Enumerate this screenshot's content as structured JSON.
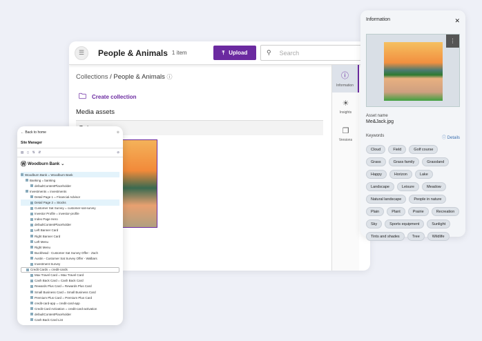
{
  "main": {
    "title": "People & Animals",
    "count": "1 item",
    "upload": "Upload",
    "search_placeholder": "Search",
    "breadcrumb": {
      "root": "Collections",
      "sep": "/",
      "current": "People & Animals"
    },
    "create_collection": "Create collection",
    "section": "Media assets",
    "group": "Today",
    "rail": [
      {
        "label": "Information",
        "icon": "info-icon"
      },
      {
        "label": "Insights",
        "icon": "sun-icon"
      },
      {
        "label": "Versions",
        "icon": "copy-icon"
      }
    ]
  },
  "info": {
    "title": "Information",
    "asset_name_label": "Asset name",
    "asset_name": "Me&Jack.jpg",
    "keywords_label": "Keywords",
    "details": "Details",
    "keywords": [
      "Cloud",
      "Field",
      "Golf course",
      "Grass",
      "Grass family",
      "Grassland",
      "Happy",
      "Horizon",
      "Lake",
      "Landscape",
      "Leisure",
      "Meadow",
      "Natural landscape",
      "People in nature",
      "Plain",
      "Plant",
      "Prairie",
      "Recreation",
      "Sky",
      "Sports equipment",
      "Sunlight",
      "Tints and shades",
      "Tree",
      "Wildlife"
    ]
  },
  "site_manager": {
    "back": "Back to home",
    "title": "Site Manager",
    "site": "Woodburn Bank",
    "tree": [
      {
        "t": "Woodburn Bank = Woodburn Bank",
        "d": 0,
        "sel": true
      },
      {
        "t": "Banking = banking",
        "d": 1
      },
      {
        "t": "defaultContentPlaceholder",
        "d": 2
      },
      {
        "t": "Investments = investments",
        "d": 1
      },
      {
        "t": "Detail Page 1 = Financial Advisor",
        "d": 2
      },
      {
        "t": "Detail Page 2 = Stocks",
        "d": 2,
        "sel": true
      },
      {
        "t": "Customer Sat Survey = customer-sat-survey",
        "d": 2
      },
      {
        "t": "Investor Profile = investor-profile",
        "d": 2
      },
      {
        "t": "Index Page Hero",
        "d": 2
      },
      {
        "t": "defaultContentPlaceholder",
        "d": 2
      },
      {
        "t": "Left Banner Card",
        "d": 2
      },
      {
        "t": "Right Banner Card",
        "d": 2
      },
      {
        "t": "Left Menu",
        "d": 2
      },
      {
        "t": "Right Menu",
        "d": 2
      },
      {
        "t": "Buckhead - Customer Sat Survey Offer - Zach",
        "d": 2
      },
      {
        "t": "Austin - Customer Sat Survey Offer - Walbars",
        "d": 2
      },
      {
        "t": "Investment Survey",
        "d": 2
      },
      {
        "t": "Credit Cards = credit-cards",
        "d": 1,
        "box": true
      },
      {
        "t": "Max Travel Card = Max Travel Card",
        "d": 2
      },
      {
        "t": "Cash Back Card = Cash Back Card",
        "d": 2
      },
      {
        "t": "Rewards Plus Card = Rewards Plus Card",
        "d": 2
      },
      {
        "t": "Small Business Card = Small Business Card",
        "d": 2
      },
      {
        "t": "Premium Plus Card = Premium Plus Card",
        "d": 2
      },
      {
        "t": "credit-card-app = credit-card-app",
        "d": 2
      },
      {
        "t": "Credit Card Activation = credit-card-activation",
        "d": 2
      },
      {
        "t": "defaultContentPlaceholder",
        "d": 2
      },
      {
        "t": "Cash Back Card List",
        "d": 2
      }
    ]
  }
}
